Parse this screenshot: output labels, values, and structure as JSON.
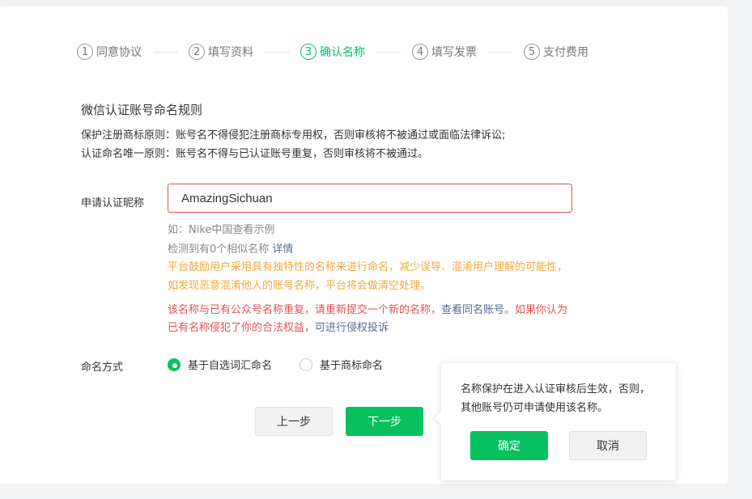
{
  "steps": [
    {
      "num": "1",
      "label": "同意协议"
    },
    {
      "num": "2",
      "label": "填写资料"
    },
    {
      "num": "3",
      "label": "确认名称"
    },
    {
      "num": "4",
      "label": "填写发票"
    },
    {
      "num": "5",
      "label": "支付费用"
    }
  ],
  "active_step": 3,
  "rules": {
    "title": "微信认证账号命名规则",
    "line1": "保护注册商标原则：账号名不得侵犯注册商标专用权，否则审核将不被通过或面临法律诉讼;",
    "line2": "认证命名唯一原则：账号名不得与已认证账号重复，否则审核将不被通过。"
  },
  "name_field": {
    "label": "申请认证昵称",
    "value": "AmazingSichuan"
  },
  "hints": {
    "example": "如：Nike中国查看示例",
    "similar_prefix": "检测到有0个相似名称",
    "similar_link": "详情",
    "warn_line1": "平台鼓励用户采用具有独特性的名称来进行命名，减少误导、混淆用户理解的可能性，",
    "warn_line2": "如发现恶意混淆他人的账号名称，平台将会做清空处理。",
    "err_line1_a": "该名称与已有公众号名称重复，请重新提交一个新的名称，",
    "err_line1_link": "查看同名账号。",
    "err_line1_b": "如果你认为",
    "err_line2_a": "已有名称侵犯了你的合法权益，",
    "err_line2_link": "可进行侵权投诉"
  },
  "naming": {
    "label": "命名方式",
    "option1": "基于自选词汇命名",
    "option2": "基于商标命名",
    "selected": "option1"
  },
  "buttons": {
    "prev": "上一步",
    "next": "下一步"
  },
  "popover": {
    "text": "名称保护在进入认证审核后生效，否则，其他账号仍可申请使用该名称。",
    "confirm": "确定",
    "cancel": "取消"
  },
  "colors": {
    "accent": "#07c160",
    "warning": "#f0a93c",
    "error": "#e05252",
    "link": "#576b95"
  }
}
